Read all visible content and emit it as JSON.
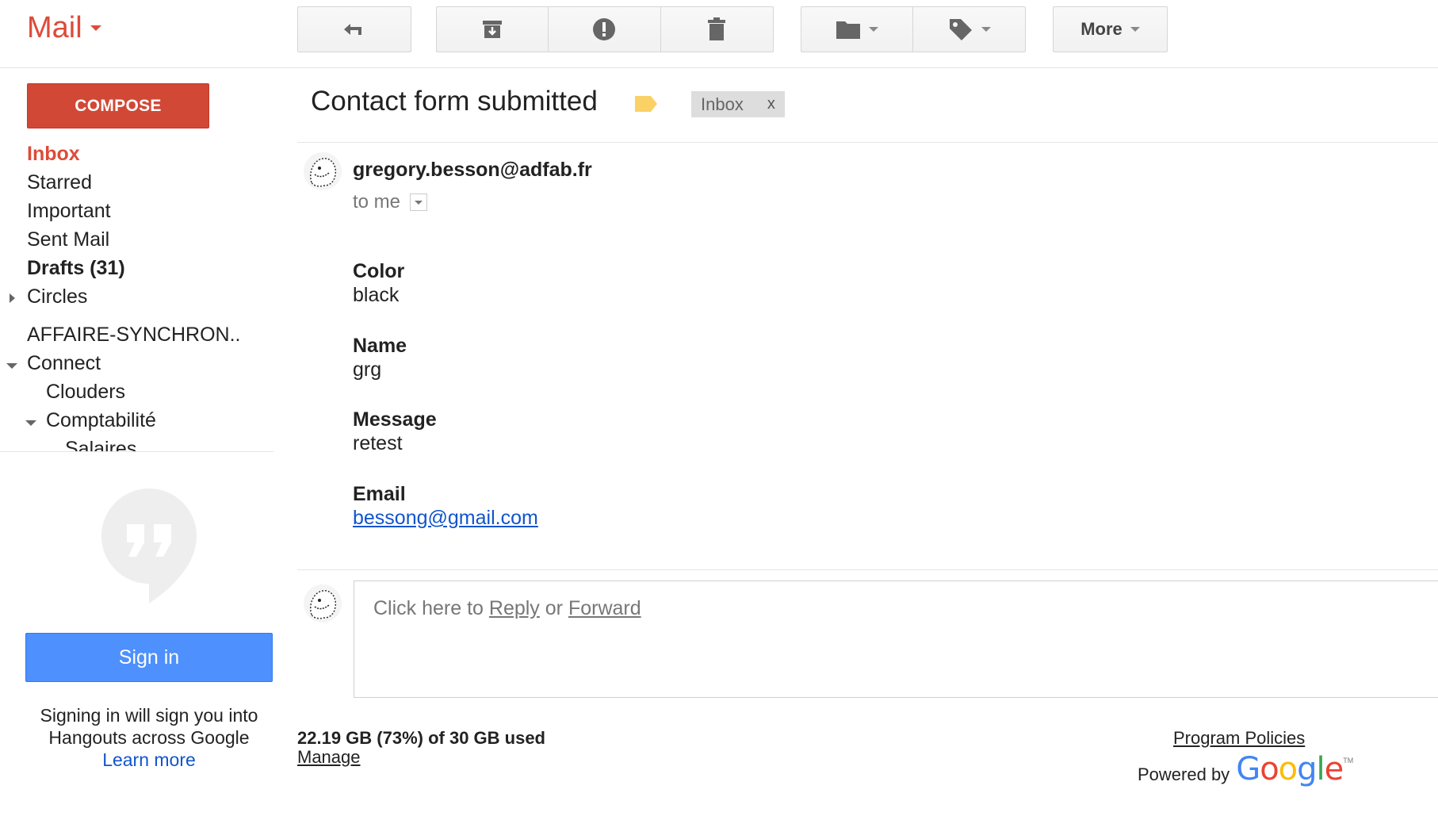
{
  "app": {
    "title": "Mail"
  },
  "toolbar": {
    "more_label": "More"
  },
  "sidebar": {
    "compose_label": "COMPOSE",
    "items": [
      {
        "label": "Inbox"
      },
      {
        "label": "Starred"
      },
      {
        "label": "Important"
      },
      {
        "label": "Sent Mail"
      },
      {
        "label": "Drafts (31)"
      },
      {
        "label": "Circles"
      },
      {
        "label": "AFFAIRE-SYNCHRON.."
      },
      {
        "label": "Connect"
      },
      {
        "label": "Clouders"
      },
      {
        "label": "Comptabilité"
      },
      {
        "label": "Salaires"
      }
    ]
  },
  "hangouts": {
    "signin_label": "Sign in",
    "text_line1": "Signing in will sign you into",
    "text_line2": "Hangouts across Google",
    "learn_more": "Learn more"
  },
  "message": {
    "subject": "Contact form submitted",
    "label_chip": "Inbox",
    "label_chip_close": "x",
    "label_color": "#fad165",
    "sender": "gregory.besson@adfab.fr",
    "recipient": "to me",
    "fields": [
      {
        "label": "Color",
        "value": "black"
      },
      {
        "label": "Name",
        "value": "grg"
      },
      {
        "label": "Message",
        "value": "retest"
      },
      {
        "label": "Email",
        "value": "bessong@gmail.com"
      }
    ]
  },
  "reply": {
    "prefix": "Click here to ",
    "reply_link": "Reply",
    "middle": " or ",
    "forward_link": "Forward"
  },
  "footer": {
    "quota": "22.19 GB (73%) of 30 GB used",
    "manage": "Manage",
    "program_policies": "Program Policies",
    "powered_by": "Powered by",
    "google": "Google",
    "tm": "TM"
  },
  "colors": {
    "brand_red": "#dd4b39",
    "compose_red": "#d14836",
    "signin_blue": "#4d90fe",
    "link_blue": "#1155cc"
  }
}
